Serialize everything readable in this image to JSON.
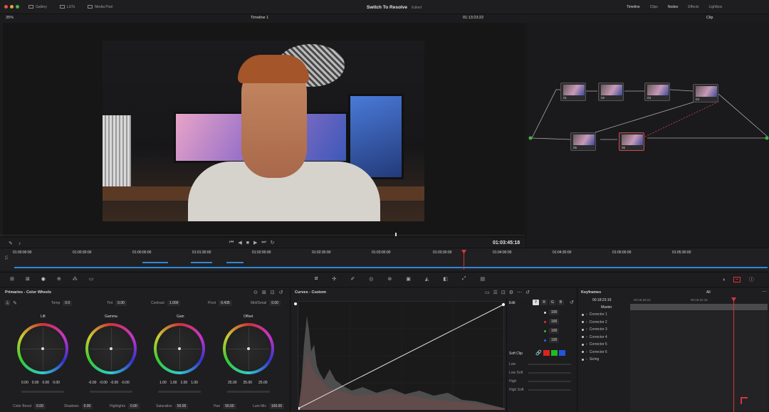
{
  "topbar": {
    "tabs": [
      "Gallery",
      "LUTs",
      "Media Pool"
    ],
    "title": "Switch To Resolve",
    "edited": "Edited",
    "right_tabs": [
      "Timeline",
      "Clips",
      "Nodes",
      "Effects",
      "Lightbox"
    ]
  },
  "viewer": {
    "zoom": "35%",
    "timeline_name": "Timeline 1",
    "timecode_top": "01:13:23:22",
    "timecode_main": "01:03:45:18",
    "node_mode": "Clip"
  },
  "ruler_ticks": [
    "01:00:00:00",
    "01:00:30:00",
    "01:00:00:00",
    "01:01:30:00",
    "01:02:00:00",
    "01:02:30:00",
    "01:03:00:00",
    "01:03:30:00",
    "01:04:00:00",
    "01:04:30:00",
    "01:05:00:00",
    "01:05:30:00"
  ],
  "nodes": [
    "01",
    "02",
    "03",
    "04",
    "05",
    "06"
  ],
  "primaries": {
    "title": "Primaries - Color Wheels",
    "temp_label": "Temp",
    "temp": "0.0",
    "tint_label": "Tint",
    "tint": "0.00",
    "contrast_label": "Contrast",
    "contrast": "1.000",
    "pivot_label": "Pivot",
    "pivot": "0.435",
    "middetail_label": "Mid/Detail",
    "middetail": "0.00",
    "wheels": [
      {
        "name": "Lift",
        "values": [
          "0.00",
          "0.00",
          "0.00",
          "0.00"
        ]
      },
      {
        "name": "Gamma",
        "values": [
          "-0.00",
          "-0.00",
          "-0.00",
          "-0.00"
        ]
      },
      {
        "name": "Gain",
        "values": [
          "1.00",
          "1.00",
          "1.00",
          "1.00"
        ]
      },
      {
        "name": "Offset",
        "values": [
          "25.00",
          "25.00",
          "25.00"
        ]
      }
    ],
    "bottom": [
      {
        "label": "Color Boost",
        "value": "0.00"
      },
      {
        "label": "Shadows",
        "value": "0.00"
      },
      {
        "label": "Highlights",
        "value": "0.00"
      },
      {
        "label": "Saturation",
        "value": "50.00"
      },
      {
        "label": "Hue",
        "value": "50.00"
      },
      {
        "label": "Lum Mix",
        "value": "100.00"
      }
    ]
  },
  "curves": {
    "title": "Curves - Custom",
    "edit_label": "Edit",
    "channels": [
      "Y",
      "R",
      "G",
      "B"
    ],
    "channel_values": [
      "100",
      "100",
      "100",
      "100"
    ],
    "soft_clip": "Soft Clip",
    "soft_labels": [
      "Low",
      "Low Soft",
      "High",
      "High Soft"
    ]
  },
  "keyframes": {
    "title": "Keyframes",
    "filter": "All",
    "timecode": "00:18:23:19",
    "t1": "00:18:20:21",
    "t2": "00:18:22:15",
    "master": "Master",
    "tracks": [
      "Corrector 1",
      "Corrector 2",
      "Corrector 3",
      "Corrector 4",
      "Corrector 5",
      "Corrector 6",
      "Sizing"
    ]
  },
  "colors": {
    "accent": "#2f86d6",
    "playhead": "#d8343a",
    "bg": "#1c1c1e"
  }
}
